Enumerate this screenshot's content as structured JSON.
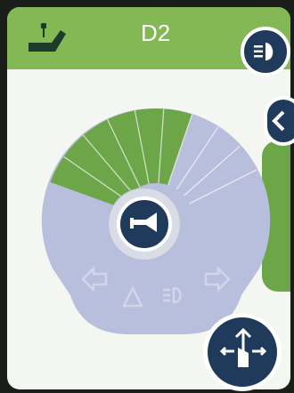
{
  "header": {
    "profile_label": "D2",
    "seat_icon": "seat-adjust-icon",
    "lights_icon": "headlights-icon"
  },
  "speed_gauge": {
    "segments_total": 10,
    "segments_lit": 6
  },
  "center_button": {
    "icon": "horn-icon"
  },
  "indicators": [
    "left-indicator-icon",
    "hazard-icon",
    "lights-icon",
    "right-indicator-icon"
  ],
  "bottom_button": {
    "icon": "joystick-control-icon"
  },
  "colors": {
    "header_green": "#84b855",
    "gauge_green": "#6da649",
    "dial_lavender": "#b8bfdc",
    "button_navy": "#1f3a5b",
    "screen_bg": "#f4f6f2"
  }
}
